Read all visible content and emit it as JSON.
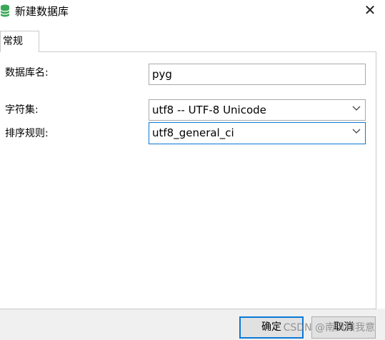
{
  "window": {
    "title": "新建数据库",
    "close_glyph": "✕"
  },
  "tabs": [
    {
      "label": "常规"
    }
  ],
  "form": {
    "db_name": {
      "label": "数据库名:",
      "value": "pyg"
    },
    "charset": {
      "label": "字符集:",
      "value": "utf8 -- UTF-8 Unicode"
    },
    "collation": {
      "label": "排序规则:",
      "value": "utf8_general_ci"
    }
  },
  "buttons": {
    "ok": "确定",
    "cancel": "取消"
  },
  "watermark": "CSDN @南风知我意",
  "colors": {
    "accent": "#0a78d7",
    "icon_green": "#3aa757",
    "footer_bg": "#f0f0f0"
  },
  "icons": {
    "app": "database-icon",
    "close": "close-icon",
    "dropdown": "chevron-down-icon"
  }
}
